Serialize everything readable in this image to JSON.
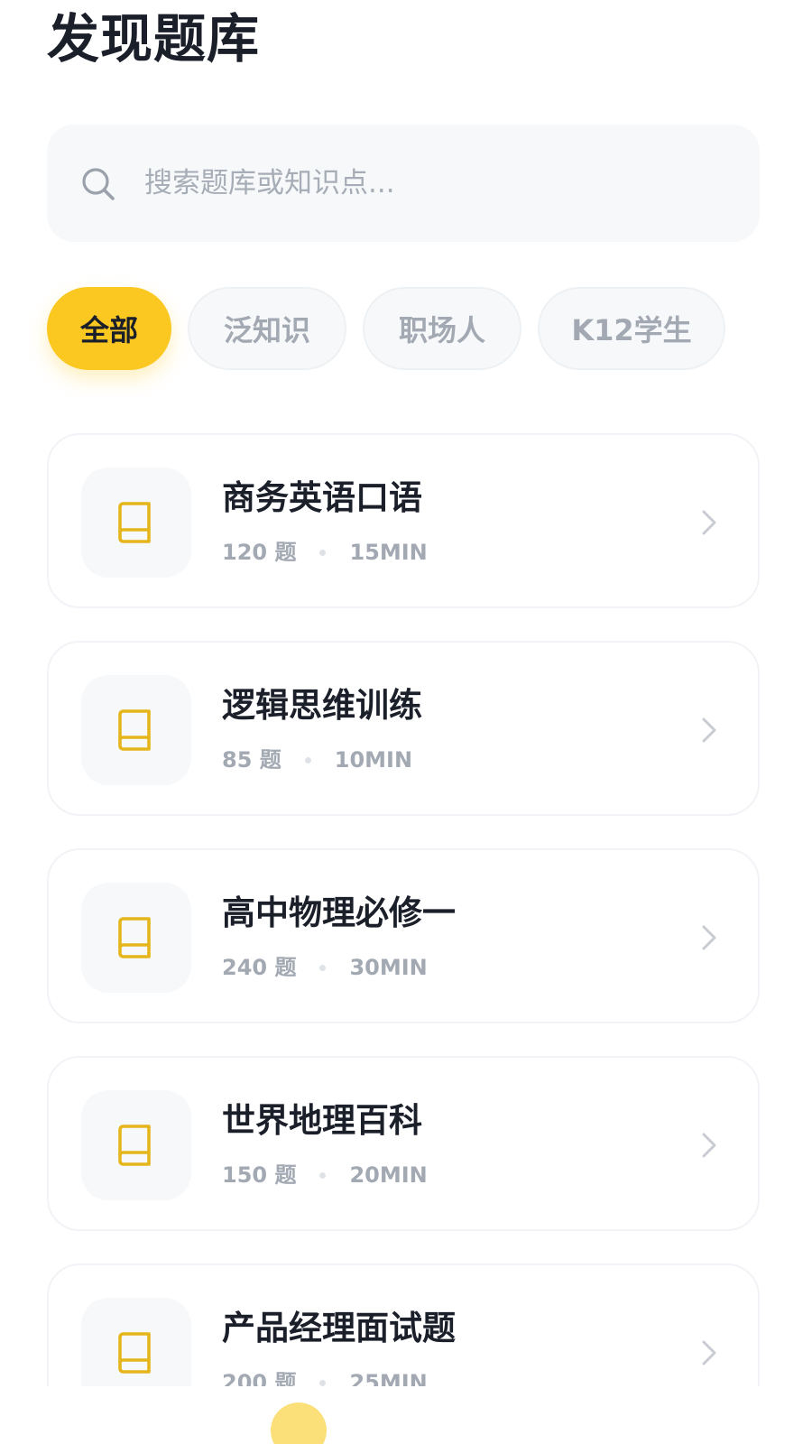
{
  "page": {
    "title": "发现题库"
  },
  "search": {
    "placeholder": "搜索题库或知识点..."
  },
  "filters": [
    {
      "label": "全部",
      "active": true
    },
    {
      "label": "泛知识",
      "active": false
    },
    {
      "label": "职场人",
      "active": false
    },
    {
      "label": "K12学生",
      "active": false
    }
  ],
  "banks": [
    {
      "title": "商务英语口语",
      "count": "120 题",
      "duration": "15MIN",
      "icon": "book-icon"
    },
    {
      "title": "逻辑思维训练",
      "count": "85 题",
      "duration": "10MIN",
      "icon": "book-icon"
    },
    {
      "title": "高中物理必修一",
      "count": "240 题",
      "duration": "30MIN",
      "icon": "book-icon"
    },
    {
      "title": "世界地理百科",
      "count": "150 题",
      "duration": "20MIN",
      "icon": "book-icon"
    },
    {
      "title": "产品经理面试题",
      "count": "200 题",
      "duration": "25MIN",
      "icon": "book-icon"
    }
  ],
  "colors": {
    "accent": "#fbc821",
    "icon": "#e5b61c",
    "text_primary": "#1b1f2a",
    "text_muted": "#a3a9b3",
    "surface": "#f6f8fa"
  }
}
